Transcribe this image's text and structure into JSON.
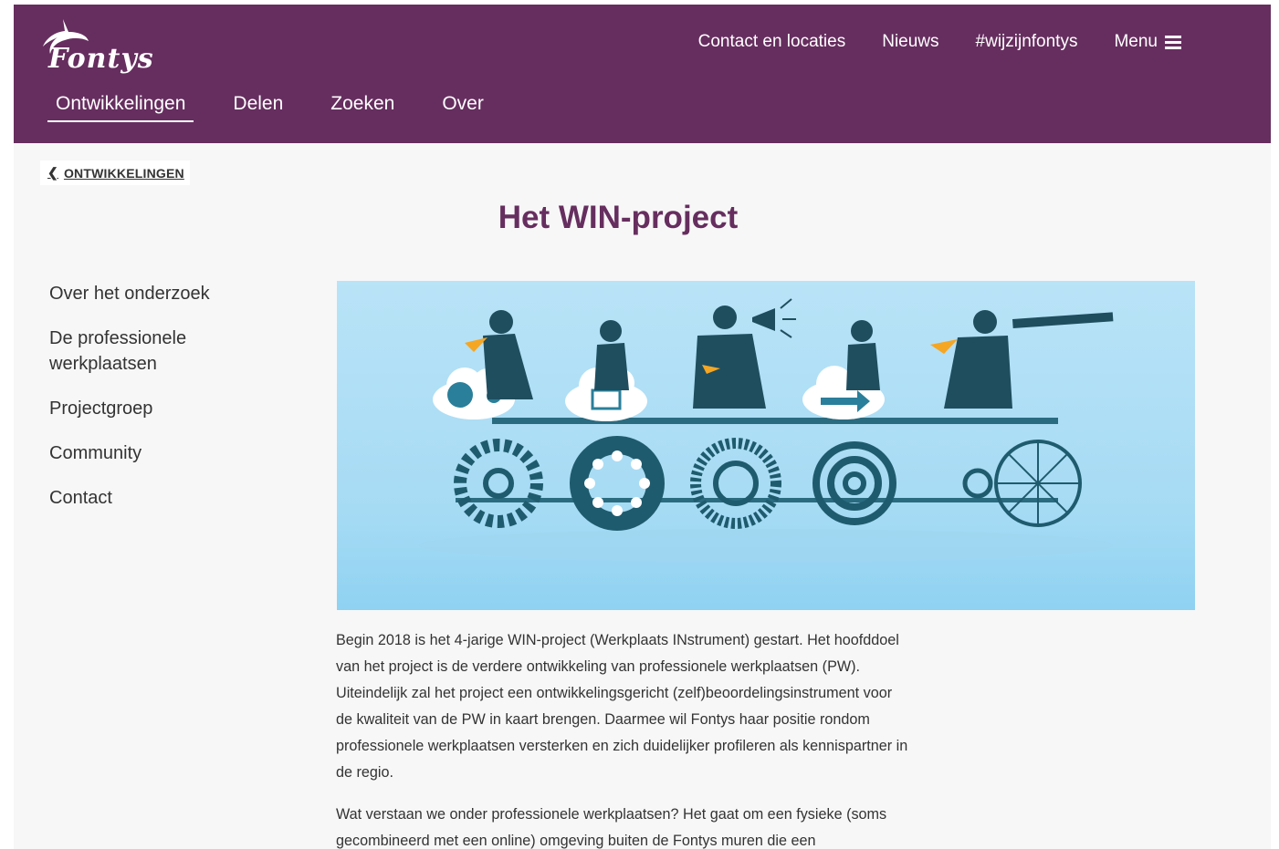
{
  "header": {
    "logo_text": "Fontys",
    "top_links": [
      {
        "label": "Contact en locaties"
      },
      {
        "label": "Nieuws"
      },
      {
        "label": "#wijzijnfontys"
      },
      {
        "label": "Menu"
      }
    ],
    "main_nav": [
      {
        "label": "Ontwikkelingen",
        "active": true
      },
      {
        "label": "Delen"
      },
      {
        "label": "Zoeken"
      },
      {
        "label": "Over"
      }
    ]
  },
  "breadcrumb": {
    "label": "ONTWIKKELINGEN",
    "icon": "chevron-left-icon"
  },
  "page_title": "Het WIN-project",
  "sidebar": {
    "items": [
      {
        "label": "Over het onderzoek"
      },
      {
        "label": "De professionele werkplaatsen"
      },
      {
        "label": "Projectgroep"
      },
      {
        "label": "Community"
      },
      {
        "label": "Contact"
      }
    ]
  },
  "article": {
    "paragraphs": [
      "Begin 2018 is het 4-jarige WIN-project (Werkplaats INstrument) gestart. Het hoofddoel van het project is de verdere ontwikkeling van professionele werkplaatsen (PW).  Uiteindelijk zal het project een ontwikkelingsgericht (zelf)beoordelingsinstrument voor de kwaliteit van de PW in kaart brengen. Daarmee wil Fontys haar positie rondom professionele werkplaatsen versterken en zich duidelijker profileren als kennispartner in de regio.",
      "Wat verstaan we onder professionele werkplaatsen? Het gaat om een fysieke (soms gecombineerd met een online) omgeving buiten de Fontys muren die een"
    ]
  },
  "colors": {
    "brand_purple": "#662e5f",
    "page_bg": "#f7f7f7",
    "illustration_sky": "#a6dbf4",
    "illustration_dark": "#1f4e5f"
  }
}
